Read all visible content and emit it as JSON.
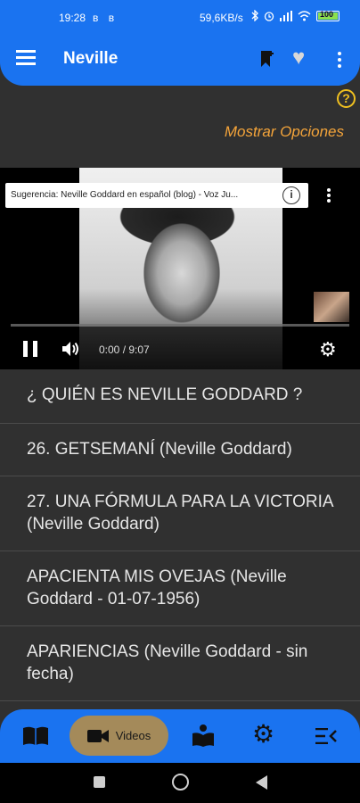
{
  "status_bar": {
    "time": "19:28",
    "left_icons": "ʙ ʙ",
    "network_speed": "59,6KB/s",
    "battery_level": "100",
    "colors": {
      "background": "#1a73f0"
    }
  },
  "app_bar": {
    "title": "Neville",
    "icons": [
      "menu-icon",
      "bookmark-add-icon",
      "heart-icon",
      "more-vert-icon"
    ]
  },
  "help_label": "?",
  "options_label": "Mostrar Opciones",
  "video": {
    "suggestion_text": "Sugerencia: Neville Goddard en español (blog) - Voz Ju...",
    "info_label": "i",
    "time_display": "0:00 / 9:07",
    "progress_fraction": 0.0
  },
  "list": {
    "items": [
      {
        "title": "¿ QUIÉN ES NEVILLE GODDARD ?"
      },
      {
        "title": "26. GETSEMANÍ (Neville Goddard)"
      },
      {
        "title": "27. UNA FÓRMULA PARA LA VICTORIA (Neville Goddard)"
      },
      {
        "title": "APACIENTA MIS OVEJAS (Neville Goddard - 01-07-1956)"
      },
      {
        "title": "APARIENCIAS (Neville Goddard - sin fecha)"
      }
    ]
  },
  "bottom_nav": {
    "items": [
      {
        "icon": "book-icon"
      },
      {
        "icon": "video-camera-icon",
        "label": "Videos",
        "active": true
      },
      {
        "icon": "reading-icon"
      },
      {
        "icon": "gear-icon"
      },
      {
        "icon": "menu-collapse-icon"
      }
    ],
    "colors": {
      "background": "#1a73f0",
      "active_pill": "#a48a5a"
    }
  },
  "accent_colors": {
    "options_text": "#f4a43a",
    "help_icon": "#f0c020"
  }
}
